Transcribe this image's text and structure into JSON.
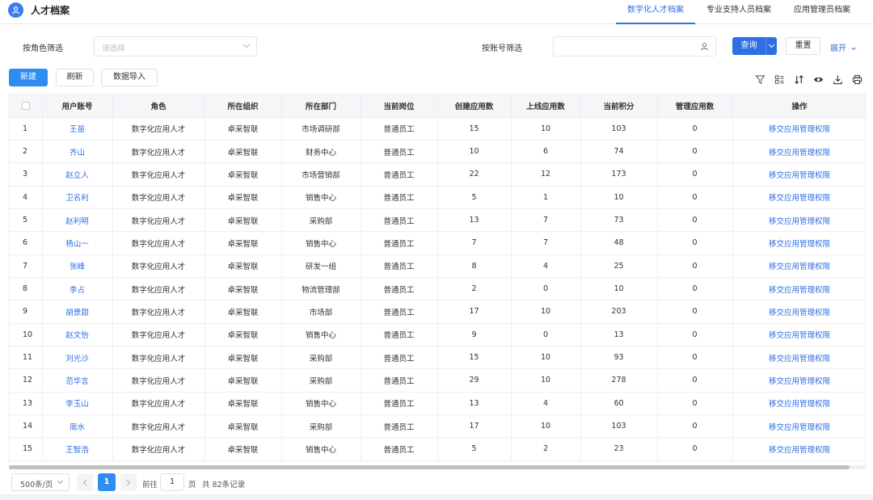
{
  "header": {
    "title": "人才档案",
    "tabs": [
      {
        "label": "数字化人才档案"
      },
      {
        "label": "专业支持人员档案"
      },
      {
        "label": "应用管理员档案"
      }
    ]
  },
  "filters": {
    "role_label": "按角色筛选",
    "role_placeholder": "请选择",
    "account_label": "按账号筛选",
    "account_value": "",
    "query_label": "查询",
    "reset_label": "重置",
    "expand_label": "展开"
  },
  "toolbar": {
    "new_label": "新建",
    "refresh_label": "刷新",
    "import_label": "数据导入",
    "icons": [
      "filter-icon",
      "columns-icon",
      "sort-icon",
      "eye-icon",
      "download-icon",
      "print-icon"
    ]
  },
  "table": {
    "columns": [
      "",
      "用户账号",
      "角色",
      "所在组织",
      "所在部门",
      "当前岗位",
      "创建应用数",
      "上线应用数",
      "当前积分",
      "管理应用数",
      "操作"
    ],
    "rows": [
      {
        "idx": "1",
        "user": "王苗",
        "role": "数字化应用人才",
        "org": "卓采智联",
        "dept": "市场调研部",
        "post": "普通员工",
        "created": "15",
        "online": "10",
        "score": "103",
        "managed": "0",
        "action": "移交应用管理权限"
      },
      {
        "idx": "2",
        "user": "齐山",
        "role": "数字化应用人才",
        "org": "卓采智联",
        "dept": "财务中心",
        "post": "普通员工",
        "created": "10",
        "online": "6",
        "score": "74",
        "managed": "0",
        "action": "移交应用管理权限"
      },
      {
        "idx": "3",
        "user": "赵立人",
        "role": "数字化应用人才",
        "org": "卓采智联",
        "dept": "市场营销部",
        "post": "普通员工",
        "created": "22",
        "online": "12",
        "score": "173",
        "managed": "0",
        "action": "移交应用管理权限"
      },
      {
        "idx": "4",
        "user": "卫名利",
        "role": "数字化应用人才",
        "org": "卓采智联",
        "dept": "销售中心",
        "post": "普通员工",
        "created": "5",
        "online": "1",
        "score": "10",
        "managed": "0",
        "action": "移交应用管理权限"
      },
      {
        "idx": "5",
        "user": "赵利明",
        "role": "数字化应用人才",
        "org": "卓采智联",
        "dept": "采购部",
        "post": "普通员工",
        "created": "13",
        "online": "7",
        "score": "73",
        "managed": "0",
        "action": "移交应用管理权限"
      },
      {
        "idx": "6",
        "user": "杨山一",
        "role": "数字化应用人才",
        "org": "卓采智联",
        "dept": "销售中心",
        "post": "普通员工",
        "created": "7",
        "online": "7",
        "score": "48",
        "managed": "0",
        "action": "移交应用管理权限"
      },
      {
        "idx": "7",
        "user": "张峰",
        "role": "数字化应用人才",
        "org": "卓采智联",
        "dept": "研发一组",
        "post": "普通员工",
        "created": "8",
        "online": "4",
        "score": "25",
        "managed": "0",
        "action": "移交应用管理权限"
      },
      {
        "idx": "8",
        "user": "李占",
        "role": "数字化应用人才",
        "org": "卓采智联",
        "dept": "物流管理部",
        "post": "普通员工",
        "created": "2",
        "online": "0",
        "score": "10",
        "managed": "0",
        "action": "移交应用管理权限"
      },
      {
        "idx": "9",
        "user": "胡景甜",
        "role": "数字化应用人才",
        "org": "卓采智联",
        "dept": "市场部",
        "post": "普通员工",
        "created": "17",
        "online": "10",
        "score": "203",
        "managed": "0",
        "action": "移交应用管理权限"
      },
      {
        "idx": "10",
        "user": "赵文怡",
        "role": "数字化应用人才",
        "org": "卓采智联",
        "dept": "销售中心",
        "post": "普通员工",
        "created": "9",
        "online": "0",
        "score": "13",
        "managed": "0",
        "action": "移交应用管理权限"
      },
      {
        "idx": "11",
        "user": "刘光沙",
        "role": "数字化应用人才",
        "org": "卓采智联",
        "dept": "采购部",
        "post": "普通员工",
        "created": "15",
        "online": "10",
        "score": "93",
        "managed": "0",
        "action": "移交应用管理权限"
      },
      {
        "idx": "12",
        "user": "范华言",
        "role": "数字化应用人才",
        "org": "卓采智联",
        "dept": "采购部",
        "post": "普通员工",
        "created": "29",
        "online": "10",
        "score": "278",
        "managed": "0",
        "action": "移交应用管理权限"
      },
      {
        "idx": "13",
        "user": "李玉山",
        "role": "数字化应用人才",
        "org": "卓采智联",
        "dept": "销售中心",
        "post": "普通员工",
        "created": "13",
        "online": "4",
        "score": "60",
        "managed": "0",
        "action": "移交应用管理权限"
      },
      {
        "idx": "14",
        "user": "周水",
        "role": "数字化应用人才",
        "org": "卓采智联",
        "dept": "采购部",
        "post": "普通员工",
        "created": "17",
        "online": "10",
        "score": "103",
        "managed": "0",
        "action": "移交应用管理权限"
      },
      {
        "idx": "15",
        "user": "王智浩",
        "role": "数字化应用人才",
        "org": "卓采智联",
        "dept": "销售中心",
        "post": "普通员工",
        "created": "5",
        "online": "2",
        "score": "23",
        "managed": "0",
        "action": "移交应用管理权限"
      }
    ]
  },
  "pagination": {
    "page_size": "500条/页",
    "current_page": "1",
    "goto_label": "前往",
    "goto_value": "1",
    "page_unit": "页",
    "total_text": "共 82条记录"
  },
  "colors": {
    "accent": "#2f6fe4",
    "primary_button": "#2f8cf0"
  }
}
